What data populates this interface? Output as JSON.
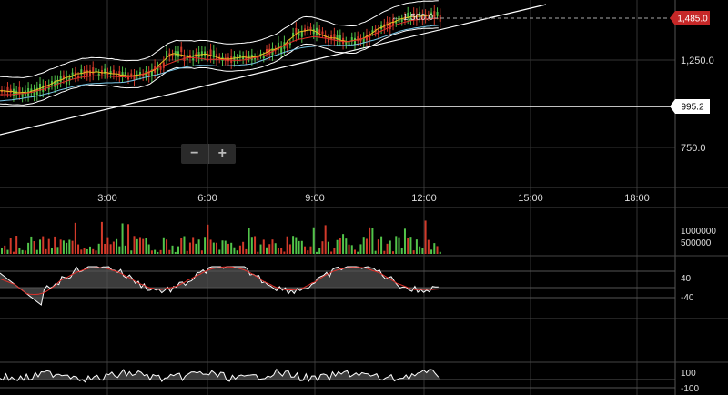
{
  "chart_data": [
    {
      "type": "candlestick",
      "title": "",
      "x_ticks": [
        "3:00",
        "6:00",
        "9:00",
        "12:00",
        "15:00",
        "18:00"
      ],
      "y_ticks": [
        "1,250.0",
        "750.0"
      ],
      "price_flags": {
        "last": "1,485.0",
        "marker": "995.2",
        "high_annotation": "1,500.0"
      },
      "overlays": [
        "bollinger-bands",
        "moving-averages",
        "trendlines"
      ],
      "approx_range": [
        600,
        1550
      ],
      "grid": true
    },
    {
      "type": "bar",
      "name": "volume",
      "y_ticks": [
        "1000000",
        "500000"
      ],
      "colors": {
        "up": "#52c44a",
        "down": "#d23a2a"
      }
    },
    {
      "type": "line",
      "name": "oscillator-1",
      "y_ticks": [
        "40",
        "-40"
      ],
      "series_colors": [
        "#ffffff",
        "#e0302a"
      ]
    },
    {
      "type": "line",
      "name": "oscillator-2",
      "y_ticks": [
        "100",
        "-100"
      ]
    }
  ],
  "zoom": {
    "minus": "−",
    "plus": "+"
  },
  "colors": {
    "up": "#52c44a",
    "down": "#d23a2a",
    "flag_red": "#c62828",
    "grid": "#333333"
  }
}
